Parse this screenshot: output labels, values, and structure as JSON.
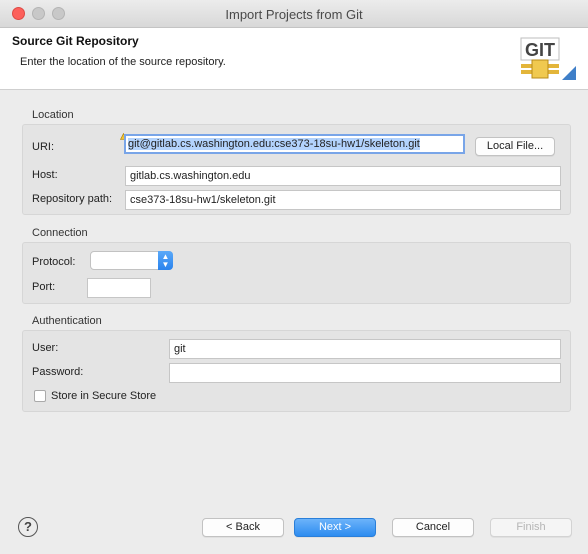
{
  "window": {
    "title": "Import Projects from Git"
  },
  "header": {
    "title": "Source Git Repository",
    "description": "Enter the location of the source repository.",
    "logo_text": "GIT"
  },
  "location": {
    "group_title": "Location",
    "uri_label": "URI:",
    "uri_value": "git@gitlab.cs.washington.edu:cse373-18su-hw1/skeleton.git",
    "local_file_label": "Local File...",
    "host_label": "Host:",
    "host_value": "gitlab.cs.washington.edu",
    "repo_path_label": "Repository path:",
    "repo_path_value": "cse373-18su-hw1/skeleton.git"
  },
  "connection": {
    "group_title": "Connection",
    "protocol_label": "Protocol:",
    "protocol_value": "",
    "port_label": "Port:",
    "port_value": ""
  },
  "authentication": {
    "group_title": "Authentication",
    "user_label": "User:",
    "user_value": "git",
    "password_label": "Password:",
    "password_value": "",
    "store_label": "Store in Secure Store",
    "store_checked": false
  },
  "footer": {
    "help_label": "?",
    "back_label": "< Back",
    "next_label": "Next >",
    "cancel_label": "Cancel",
    "finish_label": "Finish"
  },
  "colors": {
    "accent": "#2d8cf0",
    "selection": "#b3d3fd",
    "close_button": "#fc605b"
  }
}
